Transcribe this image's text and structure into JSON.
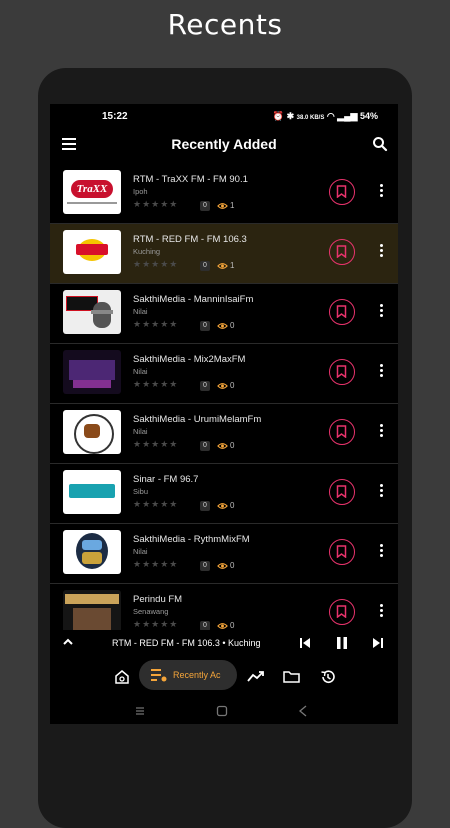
{
  "page": {
    "title": "Recents"
  },
  "status_bar": {
    "time": "15:22",
    "battery": "54%",
    "net_speed": "38.0 KB/S"
  },
  "app_bar": {
    "title": "Recently Added",
    "menu_icon": "hamburger-menu-icon",
    "search_icon": "search-icon"
  },
  "stations": [
    {
      "title": "RTM - TraXX FM - FM 90.1",
      "location": "Ipoh",
      "rating": "0",
      "views": "1",
      "active": false,
      "logo": "traxx-fm-logo"
    },
    {
      "title": "RTM - RED FM - FM 106.3",
      "location": "Kuching",
      "rating": "0",
      "views": "1",
      "active": true,
      "logo": "red-fm-logo"
    },
    {
      "title": "SakthiMedia - ManninIsaiFm",
      "location": "Nilai",
      "rating": "0",
      "views": "0",
      "active": false,
      "logo": "on-air-logo"
    },
    {
      "title": "SakthiMedia - Mix2MaxFM",
      "location": "Nilai",
      "rating": "0",
      "views": "0",
      "active": false,
      "logo": "mix2max-logo"
    },
    {
      "title": "SakthiMedia - UrumiMelamFm",
      "location": "Nilai",
      "rating": "0",
      "views": "0",
      "active": false,
      "logo": "urumi-logo"
    },
    {
      "title": "Sinar - FM 96.7",
      "location": "Sibu",
      "rating": "0",
      "views": "0",
      "active": false,
      "logo": "sinar-logo"
    },
    {
      "title": "SakthiMedia - RythmMixFM",
      "location": "Nilai",
      "rating": "0",
      "views": "0",
      "active": false,
      "logo": "rythm-mix-logo"
    },
    {
      "title": "Perindu FM",
      "location": "Senawang",
      "rating": "0",
      "views": "0",
      "active": false,
      "logo": "perindu-logo"
    }
  ],
  "player": {
    "now_playing": "RTM - RED FM - FM 106.3 • Kuching"
  },
  "bottom_nav": {
    "active_label": "Recently Ac"
  },
  "colors": {
    "accent": "#e8336c",
    "active_row": "#2b2410",
    "nav_active": "#f5a53a",
    "eye": "#f5a53a"
  }
}
